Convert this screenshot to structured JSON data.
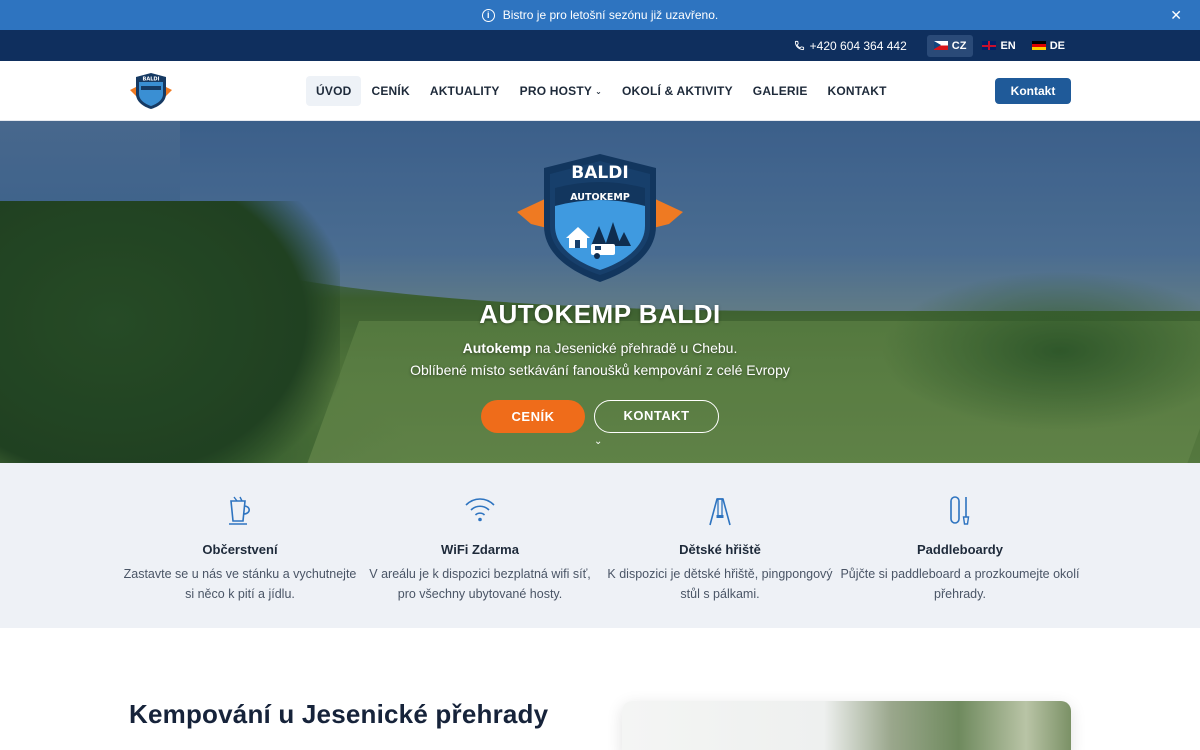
{
  "notice": {
    "text": "Bistro je pro letošní sezónu již uzavřeno."
  },
  "utility": {
    "phone": "+420 604 364 442",
    "languages": [
      {
        "code": "CZ",
        "active": true
      },
      {
        "code": "EN",
        "active": false
      },
      {
        "code": "DE",
        "active": false
      }
    ]
  },
  "nav": {
    "items": [
      {
        "label": "ÚVOD",
        "active": true
      },
      {
        "label": "CENÍK"
      },
      {
        "label": "AKTUALITY"
      },
      {
        "label": "PRO HOSTY",
        "dropdown": true
      },
      {
        "label": "OKOLÍ & AKTIVITY"
      },
      {
        "label": "GALERIE"
      },
      {
        "label": "KONTAKT"
      }
    ],
    "cta": "Kontakt"
  },
  "logo": {
    "top": "BALDI",
    "band": "AUTOKEMP"
  },
  "hero": {
    "title": "AUTOKEMP BALDI",
    "sub_bold": "Autokemp",
    "sub_rest": " na Jesenické přehradě u Chebu.",
    "sub_line2": "Oblíbené místo setkávání fanoušků kempování z celé Evropy",
    "btn_primary": "CENÍK",
    "btn_secondary": "KONTAKT"
  },
  "features": [
    {
      "icon": "cup-icon",
      "title": "Občerstvení",
      "text": "Zastavte se u nás ve stánku a vychutnejte si něco k pití a jídlu."
    },
    {
      "icon": "wifi-icon",
      "title": "WiFi Zdarma",
      "text": "V areálu je k dispozici bezplatná wifi síť, pro všechny ubytované hosty."
    },
    {
      "icon": "swing-icon",
      "title": "Dětské hřiště",
      "text": "K dispozici je dětské hřiště, pingpongový stůl s pálkami."
    },
    {
      "icon": "paddle-icon",
      "title": "Paddleboardy",
      "text": "Půjčte si paddleboard a prozkoumejte okolí přehrady."
    }
  ],
  "about": {
    "title": "Kempování u Jesenické přehrady"
  },
  "colors": {
    "notice": "#2e74c0",
    "utility": "#0f2f5e",
    "primary": "#1f5a99",
    "accent": "#ef6c1a"
  }
}
